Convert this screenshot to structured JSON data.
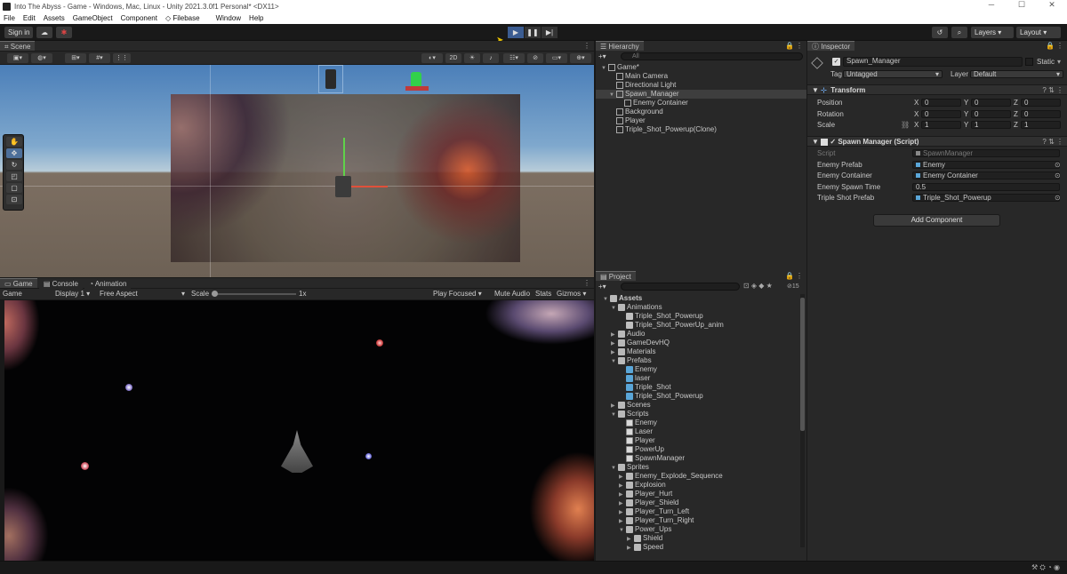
{
  "window": {
    "title": "Into The Abyss - Game - Windows, Mac, Linux - Unity 2021.3.0f1 Personal* <DX11>",
    "controls": [
      "─",
      "☐",
      "✕"
    ]
  },
  "menu": [
    "File",
    "Edit",
    "Assets",
    "GameObject",
    "Component",
    "Filebase",
    "Window",
    "Help"
  ],
  "toolbar": {
    "sign_in": "Sign in",
    "layers": "Layers",
    "layout": "Layout",
    "play": "▶",
    "pause": "❚❚",
    "step": "▶|"
  },
  "scene": {
    "tab": "Scene",
    "btn_2d": "2D"
  },
  "game": {
    "tabs": [
      "Game",
      "Console",
      "Animation"
    ],
    "mode": "Game",
    "display": "Display 1",
    "aspect": "Free Aspect",
    "scale_label": "Scale",
    "scale_value": "1x",
    "play_focused": "Play Focused",
    "mute": "Mute Audio",
    "stats": "Stats",
    "gizmos": "Gizmos"
  },
  "hierarchy": {
    "title": "Hierarchy",
    "search": "All",
    "items": [
      {
        "label": "Game*",
        "depth": 0,
        "arrow": "▼",
        "icon": "unity-scene-icon"
      },
      {
        "label": "Main Camera",
        "depth": 1,
        "arrow": "",
        "icon": "gameobject-icon"
      },
      {
        "label": "Directional Light",
        "depth": 1,
        "arrow": "",
        "icon": "gameobject-icon"
      },
      {
        "label": "Spawn_Manager",
        "depth": 1,
        "arrow": "▼",
        "icon": "gameobject-icon",
        "selected": true
      },
      {
        "label": "Enemy Container",
        "depth": 2,
        "arrow": "",
        "icon": "gameobject-icon"
      },
      {
        "label": "Background",
        "depth": 1,
        "arrow": "",
        "icon": "gameobject-icon"
      },
      {
        "label": "Player",
        "depth": 1,
        "arrow": "",
        "icon": "gameobject-icon"
      },
      {
        "label": "Triple_Shot_Powerup(Clone)",
        "depth": 1,
        "arrow": "",
        "icon": "gameobject-icon"
      }
    ]
  },
  "project": {
    "title": "Project",
    "count": "15",
    "items": [
      {
        "label": "Assets",
        "depth": 0,
        "arrow": "▼",
        "icon": "folder-icon",
        "bold": true
      },
      {
        "label": "Animations",
        "depth": 1,
        "arrow": "▼",
        "icon": "folder-icon"
      },
      {
        "label": "Triple_Shot_Powerup",
        "depth": 2,
        "arrow": "",
        "icon": "animator-icon"
      },
      {
        "label": "Triple_Shot_PowerUp_anim",
        "depth": 2,
        "arrow": "",
        "icon": "animation-icon"
      },
      {
        "label": "Audio",
        "depth": 1,
        "arrow": "▶",
        "icon": "folder-icon"
      },
      {
        "label": "GameDevHQ",
        "depth": 1,
        "arrow": "▶",
        "icon": "folder-icon"
      },
      {
        "label": "Materials",
        "depth": 1,
        "arrow": "▶",
        "icon": "folder-icon"
      },
      {
        "label": "Prefabs",
        "depth": 1,
        "arrow": "▼",
        "icon": "folder-icon"
      },
      {
        "label": "Enemy",
        "depth": 2,
        "arrow": "",
        "icon": "prefab-icon"
      },
      {
        "label": "laser",
        "depth": 2,
        "arrow": "",
        "icon": "prefab-icon"
      },
      {
        "label": "Triple_Shot",
        "depth": 2,
        "arrow": "",
        "icon": "prefab-icon"
      },
      {
        "label": "Triple_Shot_Powerup",
        "depth": 2,
        "arrow": "",
        "icon": "prefab-icon"
      },
      {
        "label": "Scenes",
        "depth": 1,
        "arrow": "▶",
        "icon": "folder-icon"
      },
      {
        "label": "Scripts",
        "depth": 1,
        "arrow": "▼",
        "icon": "folder-icon"
      },
      {
        "label": "Enemy",
        "depth": 2,
        "arrow": "",
        "icon": "script-icon"
      },
      {
        "label": "Laser",
        "depth": 2,
        "arrow": "",
        "icon": "script-icon"
      },
      {
        "label": "Player",
        "depth": 2,
        "arrow": "",
        "icon": "script-icon"
      },
      {
        "label": "PowerUp",
        "depth": 2,
        "arrow": "",
        "icon": "script-icon"
      },
      {
        "label": "SpawnManager",
        "depth": 2,
        "arrow": "",
        "icon": "script-icon"
      },
      {
        "label": "Sprites",
        "depth": 1,
        "arrow": "▼",
        "icon": "folder-icon"
      },
      {
        "label": "Enemy_Explode_Sequence",
        "depth": 2,
        "arrow": "▶",
        "icon": "folder-icon"
      },
      {
        "label": "Explosion",
        "depth": 2,
        "arrow": "▶",
        "icon": "folder-icon"
      },
      {
        "label": "Player_Hurt",
        "depth": 2,
        "arrow": "▶",
        "icon": "folder-icon"
      },
      {
        "label": "Player_Shield",
        "depth": 2,
        "arrow": "▶",
        "icon": "folder-icon"
      },
      {
        "label": "Player_Turn_Left",
        "depth": 2,
        "arrow": "▶",
        "icon": "folder-icon"
      },
      {
        "label": "Player_Turn_Right",
        "depth": 2,
        "arrow": "▶",
        "icon": "folder-icon"
      },
      {
        "label": "Power_Ups",
        "depth": 2,
        "arrow": "▼",
        "icon": "folder-icon"
      },
      {
        "label": "Shield",
        "depth": 3,
        "arrow": "▶",
        "icon": "folder-icon"
      },
      {
        "label": "Speed",
        "depth": 3,
        "arrow": "▶",
        "icon": "folder-icon"
      }
    ]
  },
  "inspector": {
    "title": "Inspector",
    "object_name": "Spawn_Manager",
    "static": "Static",
    "tag_label": "Tag",
    "tag": "Untagged",
    "layer_label": "Layer",
    "layer": "Default",
    "transform": {
      "title": "Transform",
      "rows": [
        {
          "label": "Position",
          "x": "0",
          "y": "0",
          "z": "0"
        },
        {
          "label": "Rotation",
          "x": "0",
          "y": "0",
          "z": "0"
        },
        {
          "label": "Scale",
          "x": "1",
          "y": "1",
          "z": "1"
        }
      ]
    },
    "script_comp": {
      "title": "Spawn Manager (Script)",
      "rows": [
        {
          "label": "Script",
          "value": "SpawnManager",
          "disabled": true
        },
        {
          "label": "Enemy Prefab",
          "value": "Enemy"
        },
        {
          "label": "Enemy Container",
          "value": "Enemy Container"
        },
        {
          "label": "Enemy Spawn Time",
          "value": "0.5"
        },
        {
          "label": "Triple Shot Prefab",
          "value": "Triple_Shot_Powerup"
        }
      ]
    },
    "add_component": "Add Component"
  }
}
